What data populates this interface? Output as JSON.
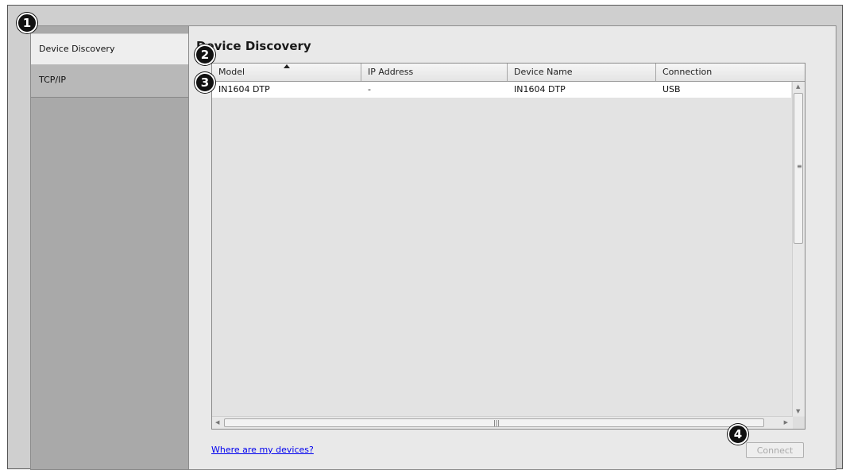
{
  "sidebar": {
    "items": [
      {
        "label": "Device Discovery",
        "active": true
      },
      {
        "label": "TCP/IP",
        "active": false
      }
    ]
  },
  "main": {
    "title": "Device Discovery",
    "table": {
      "columns": [
        "Model",
        "IP Address",
        "Device Name",
        "Connection"
      ],
      "sorted_column": "Model",
      "sort_direction": "ascending",
      "rows": [
        [
          "IN1604 DTP",
          "-",
          "IN1604 DTP",
          "USB"
        ]
      ]
    },
    "help_link": "Where are my devices?",
    "connect_button": {
      "label": "Connect",
      "enabled": false
    }
  },
  "callouts": [
    "1",
    "2",
    "3",
    "4"
  ],
  "colors": {
    "sidebar_bg": "#a9a9a9",
    "active_item_bg": "#eeeeee",
    "link": "#0000ee"
  }
}
